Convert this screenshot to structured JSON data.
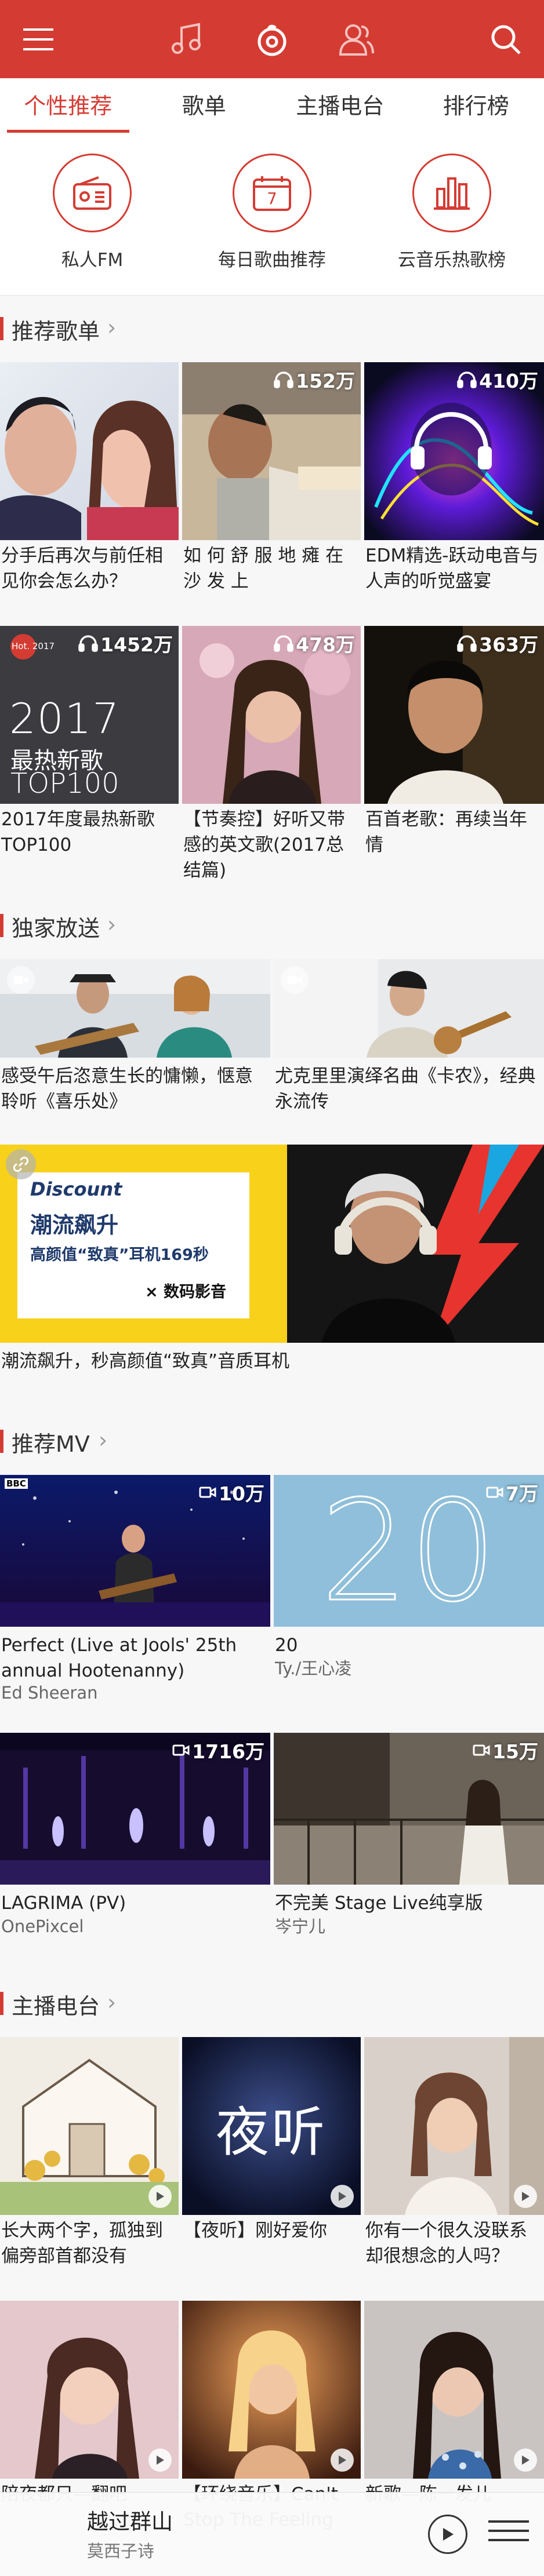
{
  "tabs": [
    "个性推荐",
    "歌单",
    "主播电台",
    "排行榜"
  ],
  "shortcuts": [
    "私人FM",
    "每日歌曲推荐",
    "云音乐热歌榜"
  ],
  "calendar_day": "7",
  "sections": {
    "playlists": "推荐歌单",
    "exclusive": "独家放送",
    "mv": "推荐MV",
    "radio": "主播电台"
  },
  "playlists": [
    {
      "count": "",
      "title": "分手后再次与前任相见你会怎么办？"
    },
    {
      "count": "152万",
      "title": "如 何 舒 服 地 瘫 在 沙 发 上"
    },
    {
      "count": "410万",
      "title": "EDM精选-跃动电音与人声的听觉盛宴"
    },
    {
      "count": "1452万",
      "title": "2017年度最热新歌TOP100"
    },
    {
      "count": "478万",
      "title": "【节奏控】好听又带感的英文歌(2017总结篇)"
    },
    {
      "count": "363万",
      "title": "百首老歌：再续当年情"
    }
  ],
  "playlist_cover_text": {
    "hot": "Hot. 2017",
    "year": "2017",
    "line1": "最热新歌",
    "line2": "TOP100"
  },
  "exclusive": [
    {
      "title": "感受午后恣意生长的慵懒，惬意聆听《喜乐处》"
    },
    {
      "title": "尤克里里演绎名曲《卡农》，经典永流传"
    }
  ],
  "banner": {
    "discount": "Discount",
    "headline": "潮流飙升",
    "desc": "高颜值“致真”耳机169秒",
    "brand": "× 数码影音",
    "caption": "潮流飙升，秒高颜值“致真”音质耳机"
  },
  "mvs": [
    {
      "count": "10万",
      "title": "Perfect (Live at Jools' 25th annual Hootenanny)",
      "artist": "Ed Sheeran",
      "tag": "BBC"
    },
    {
      "count": "7万",
      "title": "20",
      "artist": "Ty./王心凌",
      "tag": "20"
    },
    {
      "count": "1716万",
      "title": "LAGRIMA (PV)",
      "artist": "OnePixcel",
      "tag": ""
    },
    {
      "count": "15万",
      "title": "不完美 Stage Live纯享版",
      "artist": "岑宁儿",
      "tag": ""
    }
  ],
  "radio": [
    {
      "title": "长大两个字，孤独到偏旁部首都没有"
    },
    {
      "title": "【夜听】刚好爱你"
    },
    {
      "title": "你有一个很久没联系却很想念的人吗？"
    },
    {
      "title": "陪夜都只—翻吧"
    },
    {
      "title": "【环绕音乐】Can't Stop The Feeling"
    },
    {
      "title": "新歌—陈一发儿"
    }
  ],
  "radio_cover_text": "夜听",
  "player": {
    "song": "越过群山",
    "artist": "莫西子诗"
  },
  "colors": {
    "brand": "#d43c33",
    "background": "#f7f7f8"
  }
}
